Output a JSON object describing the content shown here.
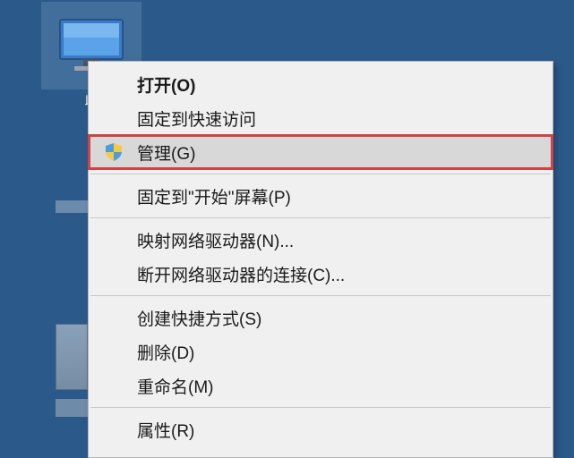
{
  "desktop": {
    "icon_label": "此"
  },
  "context_menu": {
    "items": [
      {
        "label": "打开(O)",
        "bold": true
      },
      {
        "label": "固定到快速访问"
      },
      {
        "label": "管理(G)",
        "has_shield": true,
        "highlighted": true,
        "boxed": true
      },
      {
        "separator": true
      },
      {
        "label": "固定到\"开始\"屏幕(P)"
      },
      {
        "separator": true
      },
      {
        "label": "映射网络驱动器(N)..."
      },
      {
        "label": "断开网络驱动器的连接(C)..."
      },
      {
        "separator": true
      },
      {
        "label": "创建快捷方式(S)"
      },
      {
        "label": "删除(D)"
      },
      {
        "label": "重命名(M)"
      },
      {
        "separator": true
      },
      {
        "label": "属性(R)"
      }
    ]
  }
}
